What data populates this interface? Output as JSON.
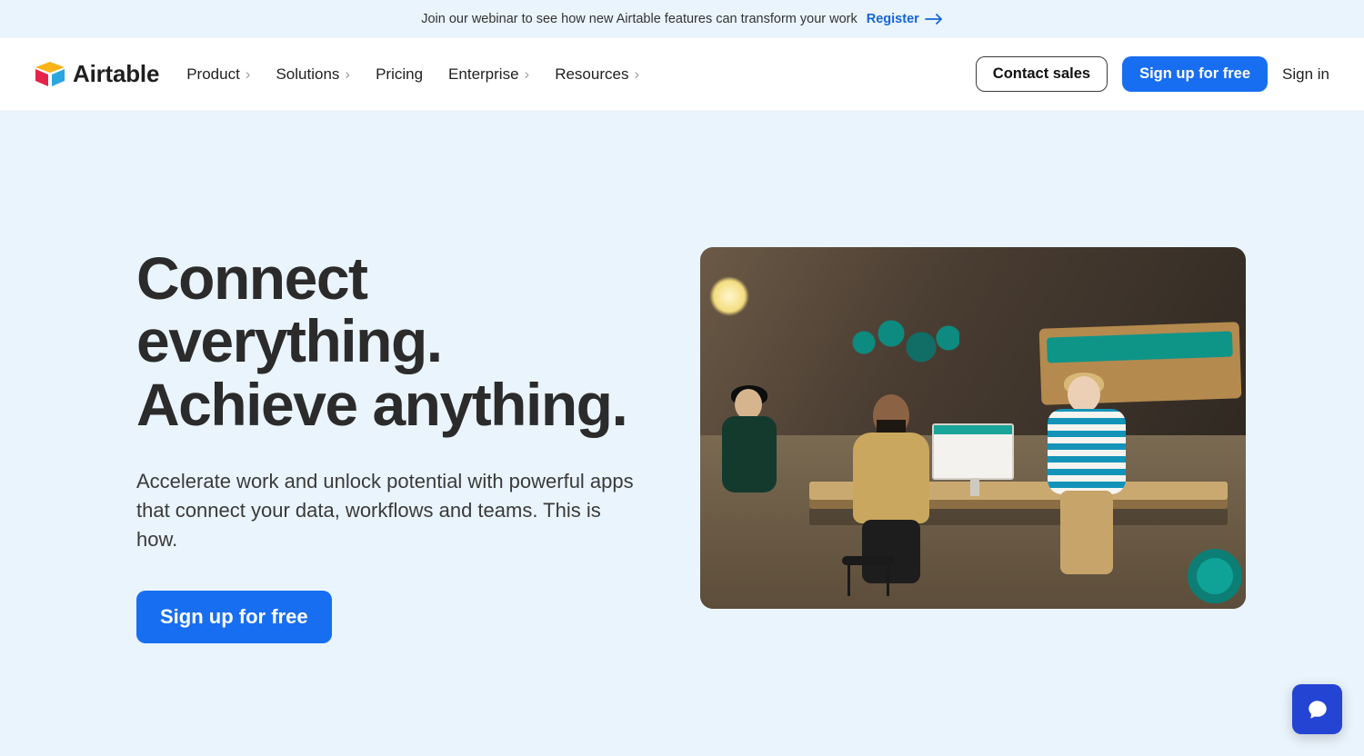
{
  "announcement": {
    "text": "Join our webinar to see how new Airtable features can transform your work",
    "link_label": "Register"
  },
  "brand": {
    "name": "Airtable"
  },
  "nav": {
    "items": [
      {
        "label": "Product",
        "has_submenu": true
      },
      {
        "label": "Solutions",
        "has_submenu": true
      },
      {
        "label": "Pricing",
        "has_submenu": false
      },
      {
        "label": "Enterprise",
        "has_submenu": true
      },
      {
        "label": "Resources",
        "has_submenu": true
      }
    ]
  },
  "header_actions": {
    "contact_sales": "Contact sales",
    "signup": "Sign up for free",
    "signin": "Sign in"
  },
  "hero": {
    "title": "Connect everything. Achieve anything.",
    "subtitle": "Accelerate work and unlock potential with powerful apps that connect your data, workflows and teams. This is how.",
    "cta": "Sign up for free"
  },
  "colors": {
    "page_bg": "#eaf4fc",
    "primary": "#186ef0",
    "chat_fab": "#2445d4",
    "logo_yellow": "#f9b317",
    "logo_red": "#e6234b",
    "logo_blue": "#2aa7e0"
  }
}
